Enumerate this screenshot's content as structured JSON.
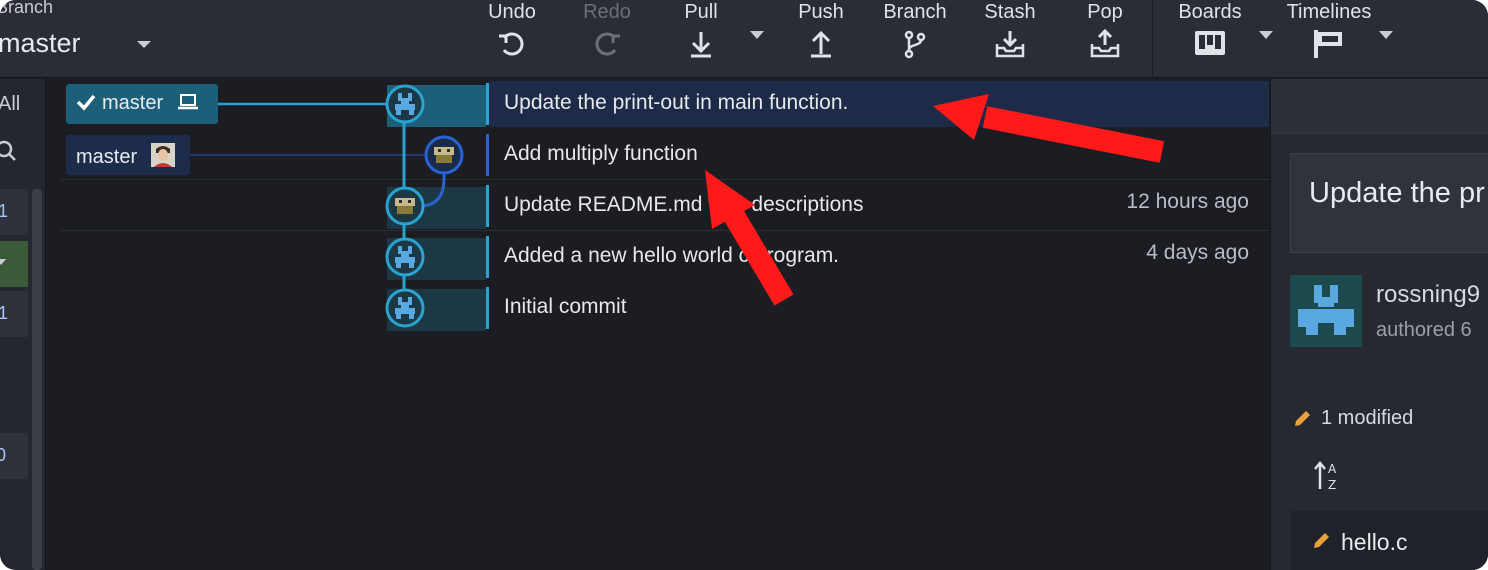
{
  "toolbar": {
    "branch_caption": "Branch",
    "branch_name": "master",
    "buttons": {
      "undo": "Undo",
      "redo": "Redo",
      "pull": "Pull",
      "push": "Push",
      "branch": "Branch",
      "stash": "Stash",
      "pop": "Pop",
      "boards": "Boards",
      "timelines": "Timelines"
    }
  },
  "leftpanel": {
    "all_label": "All",
    "count_1": "1",
    "count_2": "1",
    "count_3": "0"
  },
  "graph": {
    "refs": [
      {
        "label": "master",
        "icon": "laptop-icon"
      },
      {
        "label": "master",
        "icon": "user-avatar"
      }
    ],
    "commits": [
      {
        "message": "Update the print-out in main function.",
        "time": ""
      },
      {
        "message": "Add multiply function",
        "time": ""
      },
      {
        "message": "Update README.md with descriptions",
        "time": "12 hours ago"
      },
      {
        "message": "Added a new hello world c program.",
        "time": "4 days ago"
      },
      {
        "message": "Initial commit",
        "time": ""
      }
    ]
  },
  "details": {
    "title": "Update the pr",
    "author": "rossning9",
    "authored": "authored 6",
    "modified": "1 modified",
    "file": "hello.c"
  },
  "colors": {
    "accent": "#2aa3d1",
    "annotation_arrow": "#ff1a1a",
    "selected_row": "#1e2b48"
  }
}
